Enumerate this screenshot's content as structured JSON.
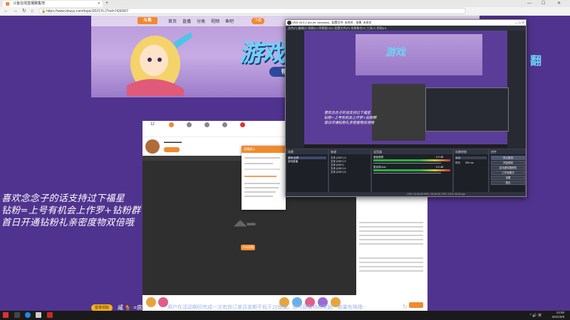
{
  "browser": {
    "tab_title": "斗鱼在线直播聚集地",
    "url": "https://www.douyu.com/topic/2021YLJ?rid=7436907",
    "nav": {
      "back": "←",
      "forward": "→",
      "refresh": "↻",
      "home": "⌂"
    },
    "newtab": "+",
    "window": {
      "minimize": "—",
      "maximize": "☐",
      "close": "✕"
    }
  },
  "site": {
    "logo": "斗鱼",
    "nav_items": [
      "首页",
      "直播",
      "分类",
      "视频",
      "鱼吧"
    ],
    "nav_button": "下载",
    "banner_title": "游戏",
    "banner_sub": "带水友",
    "right_title": "翻"
  },
  "overlay_text": [
    "喜欢念念子的话支持过下福星",
    "钻粉=上号有机会上作罗+钻粉群",
    "首日开通钻粉礼亲密度物双倍哦"
  ],
  "room": {
    "tabs": [
      "12",
      "",
      "",
      "",
      "",
      "",
      "",
      ""
    ],
    "live_button": "开始直播"
  },
  "dialog": {
    "title": "直播提示"
  },
  "obs": {
    "title": "OBS 26.0.2 (64-bit, windows) - 配置文件: 未命名 - 场景: 未命名",
    "menu": "文件(F)  编辑(E)  视图(V)  停靠窗口(D)  配置文件(P)  场景集合(S)  工具(T)  帮助(H)",
    "preview_lines": [
      "喜欢念念子的话支持过下福星",
      "钻粉=上号有机会上作罗+钻粉群",
      "首日开通钻粉礼亲密度物双倍哦"
    ],
    "docks": {
      "scenes": "场景",
      "sources": "来源",
      "mixer": "混音器",
      "transitions": "场景转换",
      "controls": "控件"
    },
    "scene_items": [
      "游戏-全屏",
      "游戏直播"
    ],
    "source_items": [
      "文本 (GDI+) 3",
      "文本 (GDI+) 2",
      "文本 (GDI+)",
      "文本 (GDI+) 4",
      "文本 (GDI+) 5"
    ],
    "mixer_items": [
      {
        "name": "桌面音频",
        "level": "0.0 dB"
      },
      {
        "name": "麦克风/Aux",
        "level": "0.0 dB"
      }
    ],
    "transition": {
      "type": "淡出",
      "duration_label": "时长",
      "duration": "300 ms"
    },
    "controls": [
      "停止推流",
      "开始录制",
      "启动虚拟摄像机",
      "工作室模式",
      "设置",
      "退出"
    ],
    "status": "LIVE: 01:40:40   REC: 00:00:00   CPU: 2.5%, 60.00 fps"
  },
  "promo": {
    "badge": "登录领取",
    "room_label": "戚 🐓 =房管",
    "text": "用户在活动期间完成一次有效订单且金额不低于10鱼翅，即可获取特权奖励！数量有限哦~",
    "refresh": "↻"
  },
  "taskbar": {
    "time": "14:50",
    "date": "2021/2/8",
    "tray_text": "^ 🔊 英"
  },
  "colors": {
    "accent": "#f08a2e",
    "page_bg": "#50338e",
    "title_cyan": "#6cd3f5"
  }
}
